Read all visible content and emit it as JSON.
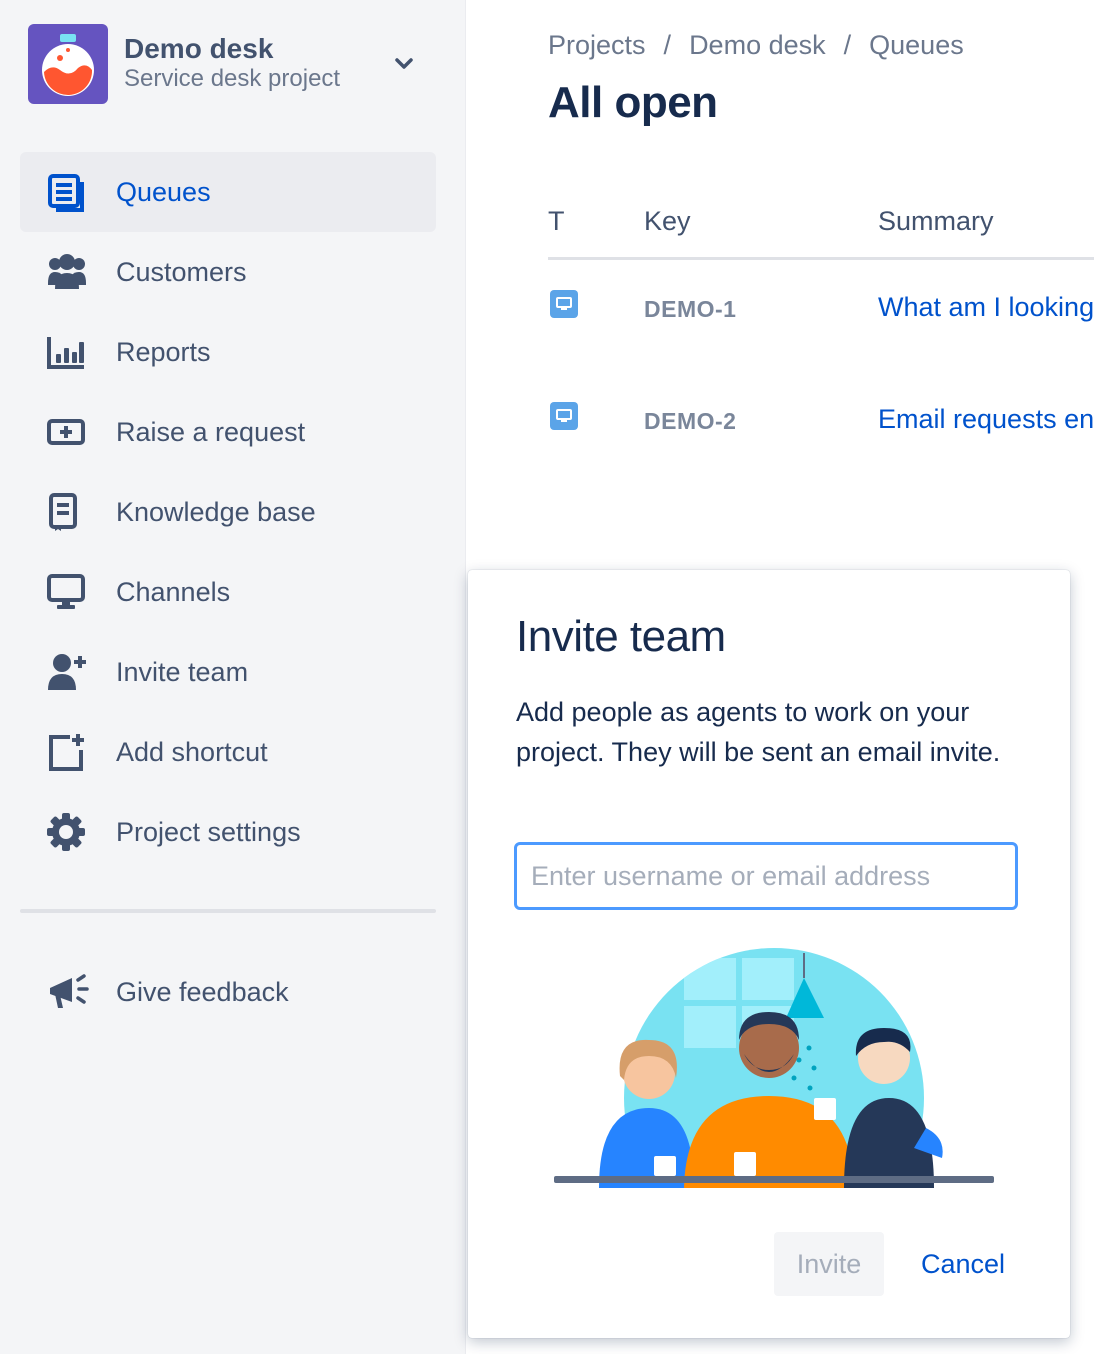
{
  "project": {
    "name": "Demo desk",
    "subtitle": "Service desk project"
  },
  "nav": {
    "items": [
      {
        "label": "Queues",
        "icon": "queues-icon",
        "active": true
      },
      {
        "label": "Customers",
        "icon": "customers-icon"
      },
      {
        "label": "Reports",
        "icon": "reports-icon"
      },
      {
        "label": "Raise a request",
        "icon": "raise-request-icon"
      },
      {
        "label": "Knowledge base",
        "icon": "knowledge-base-icon"
      },
      {
        "label": "Channels",
        "icon": "channels-icon"
      },
      {
        "label": "Invite team",
        "icon": "invite-team-icon"
      },
      {
        "label": "Add shortcut",
        "icon": "add-shortcut-icon"
      },
      {
        "label": "Project settings",
        "icon": "gear-icon"
      }
    ],
    "feedback_label": "Give feedback"
  },
  "breadcrumb": [
    "Projects",
    "Demo desk",
    "Queues"
  ],
  "breadcrumb_separator": "/",
  "page_title": "All open",
  "table": {
    "columns": [
      "T",
      "Key",
      "Summary"
    ],
    "rows": [
      {
        "key": "DEMO-1",
        "summary": "What am I looking at?"
      },
      {
        "key": "DEMO-2",
        "summary": "Email requests enabled"
      }
    ]
  },
  "dialog": {
    "title": "Invite team",
    "description": "Add people as agents to work on your project. They will be sent an email invite.",
    "input_placeholder": "Enter username or email address",
    "invite_label": "Invite",
    "cancel_label": "Cancel"
  },
  "colors": {
    "accent": "#0052cc",
    "avatar_bg": "#6554c0",
    "focus_border": "#4c9aff"
  }
}
